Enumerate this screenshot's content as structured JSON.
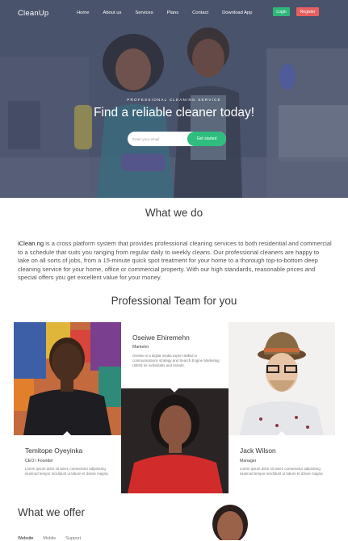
{
  "nav": {
    "logo": "CleanUp",
    "links": [
      "Home",
      "About us",
      "Services",
      "Plans",
      "Contact",
      "Download App"
    ],
    "login": "Login",
    "register": "Register"
  },
  "hero": {
    "kicker": "PROFESSIONAL CLEANING SERVICE",
    "title": "Find a reliable cleaner today!",
    "email_placeholder": "Enter your email",
    "cta": "Get started"
  },
  "about": {
    "title": "What we do",
    "brand": "iClean.ng",
    "text": " is a cross platform system that provides professional cleaning services to both residential and commercial to a schedule that suits you ranging from regular daily to weekly cleans. Our professional cleaners are happy to take on all sorts of jobs, from a 15-minute quick spot treatment for your home to a thorough top-to-bottom deep cleaning service for your home, office or commercial property. With our high standards, reasonable prices and special offers you get excellent value for your money."
  },
  "team": {
    "title": "Professional Team for you",
    "members": [
      {
        "name": "Temitope Oyeyinka",
        "role": "CEO / Founder",
        "desc": "Lorem ipsum dolor sit amet, consectetur adipisicing eiusmod tempor incididunt ut labore et dolore magna."
      },
      {
        "name": "Oseiwe Ehiremehn",
        "role": "Marketer",
        "desc": "Oseiwe is a digital media expert skilled in communications strategy and Search Engine Marketing (SEM) for individuals and brands."
      },
      {
        "name": "Jack Wilson",
        "role": "Manager",
        "desc": "Lorem ipsum dolor sit amet, consectetur adipisicing eiusmod tempor incididunt ut labore et dolore magna."
      }
    ]
  },
  "offer": {
    "title": "What we offer",
    "tabs": [
      "Website",
      "Mobile",
      "Support"
    ]
  },
  "colors": {
    "green": "#2ebd7e",
    "red": "#e85f5f",
    "hero_overlay": "#4d5670"
  }
}
